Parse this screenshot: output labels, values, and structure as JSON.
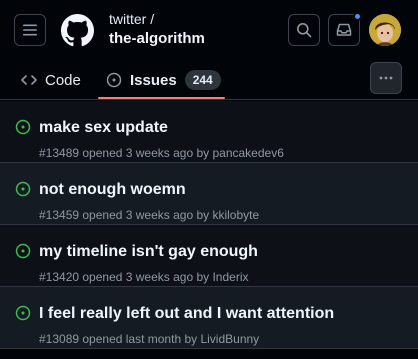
{
  "header": {
    "owner": "twitter /",
    "repo": "the-algorithm"
  },
  "tabs": [
    {
      "label": "Code"
    },
    {
      "label": "Issues",
      "count": "244"
    }
  ],
  "issues": [
    {
      "title": "make sex update",
      "meta": "#13489 opened 3 weeks ago by pancakedev6"
    },
    {
      "title": "not enough woemn",
      "meta": "#13459 opened 3 weeks ago by kkilobyte"
    },
    {
      "title": "my timeline isn't gay enough",
      "meta": "#13420 opened 3 weeks ago by Inderix"
    },
    {
      "title": "I feel really left out and I want attention",
      "meta": "#13089 opened last month by LividBunny"
    }
  ],
  "colors": {
    "accent_underline": "#f78166",
    "open_issue": "#3fb950",
    "notification": "#4493f8"
  },
  "icons": [
    "hamburger-menu-icon",
    "github-logo-icon",
    "search-icon",
    "inbox-icon",
    "code-icon",
    "issue-open-icon",
    "kebab-more-icon"
  ]
}
